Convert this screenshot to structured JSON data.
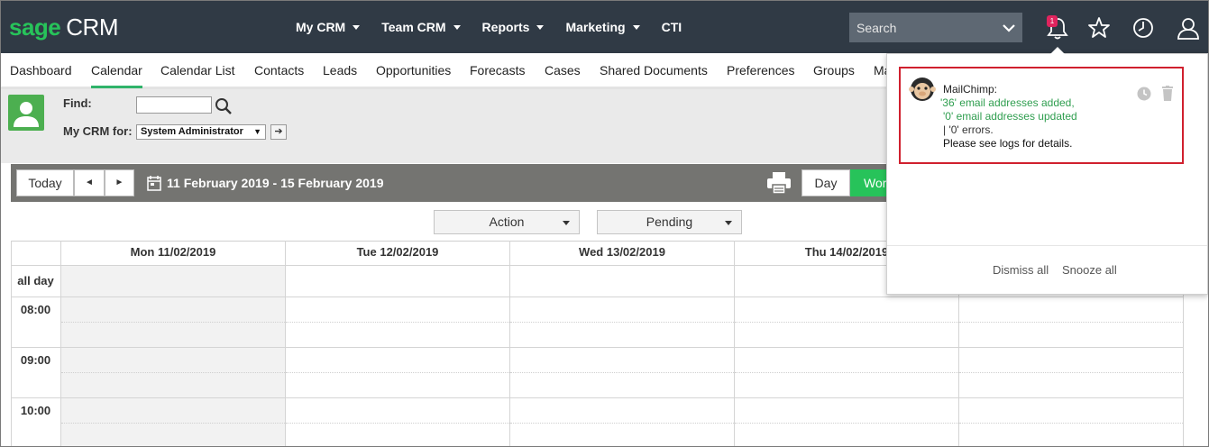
{
  "brand": {
    "sage": "sage",
    "crm": "CRM"
  },
  "top_nav": [
    {
      "label": "My CRM",
      "caret": true
    },
    {
      "label": "Team CRM",
      "caret": true
    },
    {
      "label": "Reports",
      "caret": true
    },
    {
      "label": "Marketing",
      "caret": true
    },
    {
      "label": "CTI",
      "caret": false
    }
  ],
  "search": {
    "placeholder": "Search"
  },
  "notifications": {
    "count": "1"
  },
  "tabs": [
    "Dashboard",
    "Calendar",
    "Calendar List",
    "Contacts",
    "Leads",
    "Opportunities",
    "Forecasts",
    "Cases",
    "Shared Documents",
    "Preferences",
    "Groups",
    "Ma"
  ],
  "active_tab": "Calendar",
  "find": {
    "find_label": "Find:",
    "mycrm_label": "My CRM for:",
    "user_selected": "System Administrator",
    "go_glyph": "➔"
  },
  "toolbar": {
    "today": "Today",
    "prev": "◄",
    "next": "►",
    "date_range": "11 February 2019 - 15 February 2019",
    "day": "Day",
    "work": "Wor"
  },
  "filters": {
    "action": "Action",
    "pending": "Pending"
  },
  "calendar": {
    "days": [
      "Mon 11/02/2019",
      "Tue 12/02/2019",
      "Wed 13/02/2019",
      "Thu 14/02/2019",
      ""
    ],
    "allday_label": "all day",
    "times": [
      "08:00",
      "09:00",
      "10:00"
    ]
  },
  "popup": {
    "source": "MailChimp:",
    "line1": "'36' email addresses added,",
    "line2": "'0' email addresses updated",
    "line3": "| '0' errors.",
    "line4": "Please see logs for details.",
    "dismiss_all": "Dismiss all",
    "snooze_all": "Snooze all"
  },
  "colors": {
    "topbar": "#303a45",
    "brand_green": "#27c35a",
    "toolbar_bg": "#747471",
    "highlight_red": "#d0202e",
    "message_green": "#2f9e4f"
  }
}
